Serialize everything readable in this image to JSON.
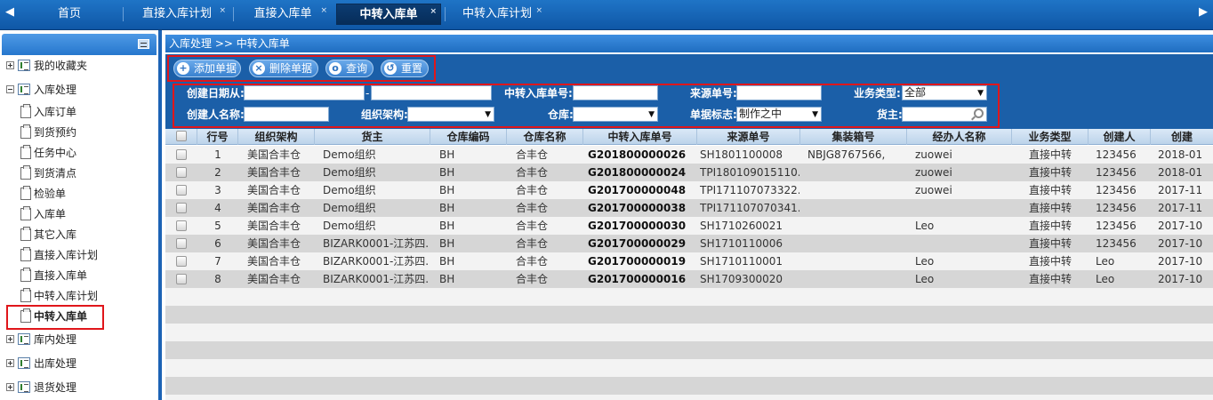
{
  "tabs": [
    {
      "label": "首页"
    },
    {
      "label": "直接入库计划"
    },
    {
      "label": "直接入库单"
    },
    {
      "label": "中转入库单"
    },
    {
      "label": "中转入库计划"
    }
  ],
  "tab_close_glyph": "×",
  "sidebar": {
    "items": [
      {
        "label": "我的收藏夹",
        "kind": "folder",
        "expanded": false
      },
      {
        "label": "入库处理",
        "kind": "folder",
        "expanded": true
      },
      {
        "label": "入库订单",
        "kind": "page"
      },
      {
        "label": "到货预约",
        "kind": "page"
      },
      {
        "label": "任务中心",
        "kind": "page"
      },
      {
        "label": "到货清点",
        "kind": "page"
      },
      {
        "label": "检验单",
        "kind": "page"
      },
      {
        "label": "入库单",
        "kind": "page"
      },
      {
        "label": "其它入库",
        "kind": "page"
      },
      {
        "label": "直接入库计划",
        "kind": "page"
      },
      {
        "label": "直接入库单",
        "kind": "page"
      },
      {
        "label": "中转入库计划",
        "kind": "page"
      },
      {
        "label": "中转入库单",
        "kind": "page",
        "selected": true
      },
      {
        "label": "库内处理",
        "kind": "folder",
        "expanded": false
      },
      {
        "label": "出库处理",
        "kind": "folder",
        "expanded": false
      },
      {
        "label": "退货处理",
        "kind": "folder",
        "expanded": false
      }
    ]
  },
  "breadcrumb": "入库处理 >> 中转入库单",
  "toolbar": {
    "add": "添加单据",
    "delete": "删除单据",
    "query": "查询",
    "reset": "重置"
  },
  "filters": {
    "create_date_label": "创建日期从:",
    "date_separator": "-",
    "transfer_no_label": "中转入库单号:",
    "source_no_label": "来源单号:",
    "biz_type_label": "业务类型:",
    "biz_type_value": "全部",
    "creator_label": "创建人名称:",
    "org_label": "组织架构:",
    "warehouse_label": "仓库:",
    "flag_label": "单据标志:",
    "flag_value": "制作之中",
    "owner_label": "货主:"
  },
  "grid": {
    "columns": [
      "行号",
      "组织架构",
      "货主",
      "仓库编码",
      "仓库名称",
      "中转入库单号",
      "来源单号",
      "集装箱号",
      "经办人名称",
      "业务类型",
      "创建人",
      "创建"
    ],
    "rows": [
      {
        "no": "1",
        "org": "美国合丰仓",
        "owner": "Demo组织",
        "wh_code": "BH",
        "wh_name": "合丰仓",
        "doc_no": "G201800000026",
        "src": "SH1801100008",
        "container": "NBJG8767566,",
        "handler": "zuowei",
        "biz": "直接中转",
        "creator": "123456",
        "created": "2018-01"
      },
      {
        "no": "2",
        "org": "美国合丰仓",
        "owner": "Demo组织",
        "wh_code": "BH",
        "wh_name": "合丰仓",
        "doc_no": "G201800000024",
        "src": "TPI180109015110...",
        "container": "",
        "handler": "zuowei",
        "biz": "直接中转",
        "creator": "123456",
        "created": "2018-01"
      },
      {
        "no": "3",
        "org": "美国合丰仓",
        "owner": "Demo组织",
        "wh_code": "BH",
        "wh_name": "合丰仓",
        "doc_no": "G201700000048",
        "src": "TPI171107073322...",
        "container": "",
        "handler": "zuowei",
        "biz": "直接中转",
        "creator": "123456",
        "created": "2017-11"
      },
      {
        "no": "4",
        "org": "美国合丰仓",
        "owner": "Demo组织",
        "wh_code": "BH",
        "wh_name": "合丰仓",
        "doc_no": "G201700000038",
        "src": "TPI171107070341...",
        "container": "",
        "handler": "",
        "biz": "直接中转",
        "creator": "123456",
        "created": "2017-11"
      },
      {
        "no": "5",
        "org": "美国合丰仓",
        "owner": "Demo组织",
        "wh_code": "BH",
        "wh_name": "合丰仓",
        "doc_no": "G201700000030",
        "src": "SH1710260021",
        "container": "",
        "handler": "Leo",
        "biz": "直接中转",
        "creator": "123456",
        "created": "2017-10"
      },
      {
        "no": "6",
        "org": "美国合丰仓",
        "owner": "BIZARK0001-江苏四...",
        "wh_code": "BH",
        "wh_name": "合丰仓",
        "doc_no": "G201700000029",
        "src": "SH1710110006",
        "container": "",
        "handler": "",
        "biz": "直接中转",
        "creator": "123456",
        "created": "2017-10"
      },
      {
        "no": "7",
        "org": "美国合丰仓",
        "owner": "BIZARK0001-江苏四...",
        "wh_code": "BH",
        "wh_name": "合丰仓",
        "doc_no": "G201700000019",
        "src": "SH1710110001",
        "container": "",
        "handler": "Leo",
        "biz": "直接中转",
        "creator": "Leo",
        "created": "2017-10"
      },
      {
        "no": "8",
        "org": "美国合丰仓",
        "owner": "BIZARK0001-江苏四...",
        "wh_code": "BH",
        "wh_name": "合丰仓",
        "doc_no": "G201700000016",
        "src": "SH1709300020",
        "container": "",
        "handler": "Leo",
        "biz": "直接中转",
        "creator": "Leo",
        "created": "2017-10"
      }
    ]
  },
  "colors": {
    "primary_blue": "#1b5fa8",
    "highlight_red": "#e0161b",
    "row_odd": "#f3f3f3",
    "row_even": "#d6d6d6"
  }
}
